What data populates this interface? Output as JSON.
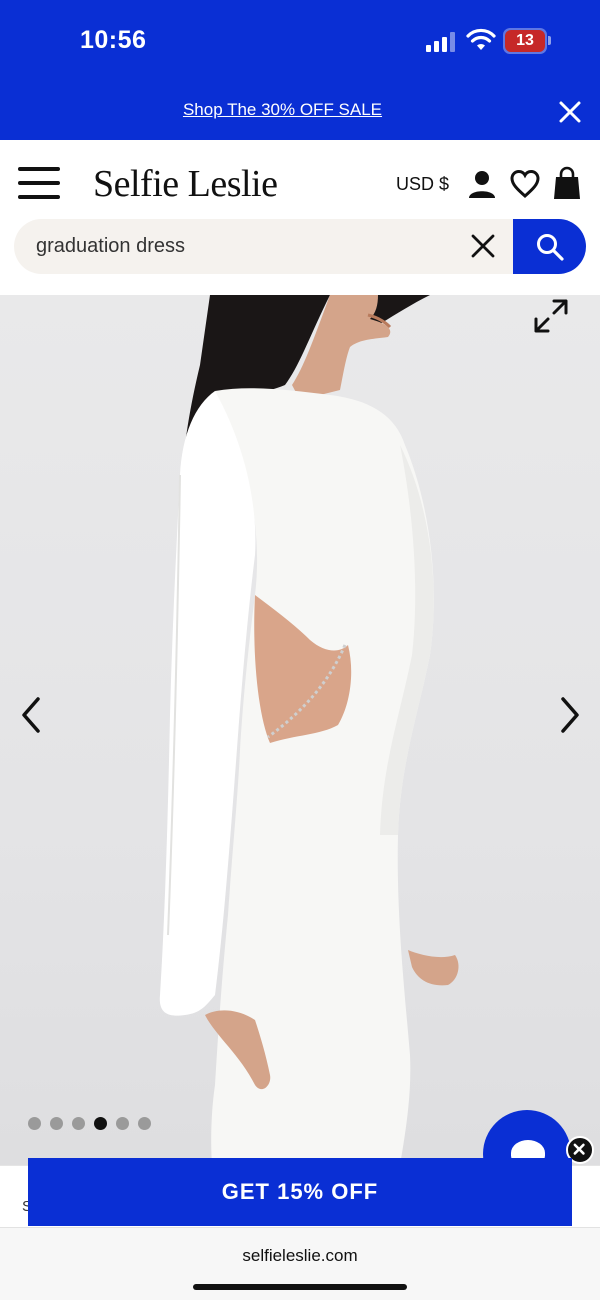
{
  "status_bar": {
    "time": "10:56",
    "battery": "13"
  },
  "promo": {
    "text": "Shop The 30% OFF SALE",
    "close_icon": "close-icon"
  },
  "header": {
    "logo": "Selfie Leslie",
    "currency": "USD $",
    "icons": [
      "menu-icon",
      "user-icon",
      "heart-icon",
      "bag-icon"
    ]
  },
  "search": {
    "value": "graduation dress",
    "placeholder": ""
  },
  "gallery": {
    "total_images": 6,
    "active_index": 3
  },
  "cta": {
    "label": "GET 15% OFF",
    "hidden_text": "S"
  },
  "browser": {
    "url": "selfieleslie.com"
  },
  "colors": {
    "brand_blue": "#0a2fd4",
    "ink": "#111111"
  }
}
